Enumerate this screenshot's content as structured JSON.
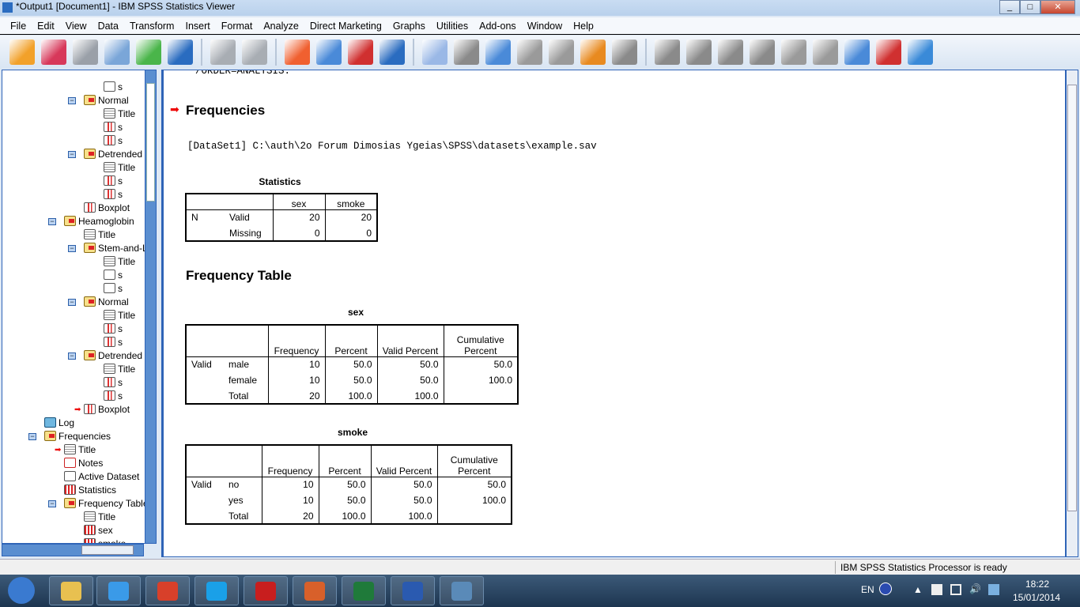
{
  "window": {
    "title": "*Output1 [Document1] - IBM SPSS Statistics Viewer",
    "buttons": [
      "minimize",
      "maximize",
      "close"
    ]
  },
  "menu": [
    "File",
    "Edit",
    "View",
    "Data",
    "Transform",
    "Insert",
    "Format",
    "Analyze",
    "Direct Marketing",
    "Graphs",
    "Utilities",
    "Add-ons",
    "Window",
    "Help"
  ],
  "toolbar": [
    {
      "icon": "open-folder-icon",
      "color": "#f2a12a"
    },
    {
      "icon": "save-icon",
      "color": "#d7385a"
    },
    {
      "icon": "print-icon",
      "color": "#9aa0a8"
    },
    {
      "icon": "print-preview-icon",
      "color": "#7aa6d8"
    },
    {
      "icon": "export-icon",
      "color": "#4ab54a"
    },
    {
      "icon": "recall-dialog-icon",
      "color": "#2a6cc0"
    },
    {
      "sep": true
    },
    {
      "icon": "undo-icon",
      "color": "#a8adb3"
    },
    {
      "icon": "redo-icon",
      "color": "#a8adb3"
    },
    {
      "sep": true
    },
    {
      "icon": "goto-data-icon",
      "color": "#f06030"
    },
    {
      "icon": "goto-case-icon",
      "color": "#4a8ad8"
    },
    {
      "icon": "goto-variable-icon",
      "color": "#d03030"
    },
    {
      "icon": "variables-icon",
      "color": "#2a6cc0"
    },
    {
      "sep": true
    },
    {
      "icon": "use-sets-icon",
      "color": "#9ab8e6"
    },
    {
      "icon": "show-all-variables-icon",
      "color": "#8a8a8a"
    },
    {
      "icon": "spell-check-icon",
      "color": "#4a8ad8"
    },
    {
      "icon": "promote-icon",
      "color": "#9a9a9a"
    },
    {
      "icon": "designate-window-icon",
      "color": "#9a9a9a"
    },
    {
      "icon": "run-script-icon",
      "color": "#e88a20"
    },
    {
      "icon": "select-last-output-icon",
      "color": "#8a8a8a"
    },
    {
      "sep": true
    },
    {
      "icon": "arrow-left-icon",
      "color": "#8a8a8a"
    },
    {
      "icon": "arrow-right-icon",
      "color": "#8a8a8a"
    },
    {
      "icon": "expand-plus-icon",
      "color": "#8a8a8a"
    },
    {
      "icon": "collapse-minus-icon",
      "color": "#8a8a8a"
    },
    {
      "icon": "show-icon",
      "color": "#9a9a9a"
    },
    {
      "icon": "hide-icon",
      "color": "#9a9a9a"
    },
    {
      "icon": "insert-heading-icon",
      "color": "#4a8ad8"
    },
    {
      "icon": "insert-title-icon",
      "color": "#d03030"
    },
    {
      "icon": "insert-text-icon",
      "color": "#3a8ad8"
    }
  ],
  "tree": [
    {
      "level": 4,
      "icon": "doc",
      "label": "s"
    },
    {
      "level": 3,
      "icon": "book",
      "label": "Normal",
      "minus": true
    },
    {
      "level": 4,
      "icon": "title",
      "label": "Title"
    },
    {
      "level": 4,
      "icon": "chart",
      "label": "s"
    },
    {
      "level": 4,
      "icon": "chart",
      "label": "s"
    },
    {
      "level": 3,
      "icon": "book",
      "label": "Detrended",
      "minus": true
    },
    {
      "level": 4,
      "icon": "title",
      "label": "Title"
    },
    {
      "level": 4,
      "icon": "chart",
      "label": "s"
    },
    {
      "level": 4,
      "icon": "chart",
      "label": "s"
    },
    {
      "level": 3,
      "icon": "chart",
      "label": "Boxplot"
    },
    {
      "level": 2,
      "icon": "book",
      "label": "Heamoglobin",
      "minus": true
    },
    {
      "level": 3,
      "icon": "title",
      "label": "Title"
    },
    {
      "level": 3,
      "icon": "book",
      "label": "Stem-and-Leaf",
      "minus": true
    },
    {
      "level": 4,
      "icon": "title",
      "label": "Title"
    },
    {
      "level": 4,
      "icon": "doc",
      "label": "s"
    },
    {
      "level": 4,
      "icon": "doc",
      "label": "s"
    },
    {
      "level": 3,
      "icon": "book",
      "label": "Normal",
      "minus": true
    },
    {
      "level": 4,
      "icon": "title",
      "label": "Title"
    },
    {
      "level": 4,
      "icon": "chart",
      "label": "s"
    },
    {
      "level": 4,
      "icon": "chart",
      "label": "s"
    },
    {
      "level": 3,
      "icon": "book",
      "label": "Detrended",
      "minus": true
    },
    {
      "level": 4,
      "icon": "title",
      "label": "Title"
    },
    {
      "level": 4,
      "icon": "chart",
      "label": "s"
    },
    {
      "level": 4,
      "icon": "chart",
      "label": "s"
    },
    {
      "level": 3,
      "icon": "chart",
      "label": "Boxplot",
      "arrow": true
    },
    {
      "level": 1,
      "icon": "log",
      "label": "Log"
    },
    {
      "level": 1,
      "icon": "book",
      "label": "Frequencies",
      "minus": true
    },
    {
      "level": 2,
      "icon": "title",
      "label": "Title",
      "arrow": true
    },
    {
      "level": 2,
      "icon": "notes",
      "label": "Notes"
    },
    {
      "level": 2,
      "icon": "doc",
      "label": "Active Dataset"
    },
    {
      "level": 2,
      "icon": "table",
      "label": "Statistics"
    },
    {
      "level": 2,
      "icon": "book",
      "label": "Frequency Table",
      "minus": true
    },
    {
      "level": 3,
      "icon": "title",
      "label": "Title"
    },
    {
      "level": 3,
      "icon": "table",
      "label": "sex"
    },
    {
      "level": 3,
      "icon": "table",
      "label": "smoke"
    }
  ],
  "output": {
    "syntax_tail": "/ORDER=ANALYSIS.",
    "heading": "Frequencies",
    "dataset": "[DataSet1] C:\\auth\\2o Forum Dimosias Ygeias\\SPSS\\datasets\\example.sav",
    "statistics": {
      "title": "Statistics",
      "cols": [
        "sex",
        "smoke"
      ],
      "rows": [
        [
          "N",
          "Valid",
          "20",
          "20"
        ],
        [
          "",
          "Missing",
          "0",
          "0"
        ]
      ]
    },
    "freq_heading": "Frequency Table",
    "tables": [
      {
        "title": "sex",
        "cols": [
          "Frequency",
          "Percent",
          "Valid Percent",
          "Cumulative Percent"
        ],
        "rows": [
          [
            "Valid",
            "male",
            "10",
            "50.0",
            "50.0",
            "50.0"
          ],
          [
            "",
            "female",
            "10",
            "50.0",
            "50.0",
            "100.0"
          ],
          [
            "",
            "Total",
            "20",
            "100.0",
            "100.0",
            ""
          ]
        ]
      },
      {
        "title": "smoke",
        "cols": [
          "Frequency",
          "Percent",
          "Valid Percent",
          "Cumulative Percent"
        ],
        "rows": [
          [
            "Valid",
            "no",
            "10",
            "50.0",
            "50.0",
            "50.0"
          ],
          [
            "",
            "yes",
            "10",
            "50.0",
            "50.0",
            "100.0"
          ],
          [
            "",
            "Total",
            "20",
            "100.0",
            "100.0",
            ""
          ]
        ]
      }
    ]
  },
  "status": {
    "message": "IBM SPSS Statistics Processor is ready"
  },
  "taskbar": {
    "apps": [
      {
        "icon": "start-orb-icon",
        "color": "#3a7ad0"
      },
      {
        "icon": "file-explorer-icon",
        "color": "#e8c050"
      },
      {
        "icon": "internet-explorer-icon",
        "color": "#3a9ae8"
      },
      {
        "icon": "chrome-icon",
        "color": "#d8402a"
      },
      {
        "icon": "skype-icon",
        "color": "#1aa0e8"
      },
      {
        "icon": "acrobat-icon",
        "color": "#c81e1e"
      },
      {
        "icon": "powerpoint-icon",
        "color": "#d8602a"
      },
      {
        "icon": "excel-icon",
        "color": "#1f7a3a"
      },
      {
        "icon": "word-icon",
        "color": "#2a5ab0"
      },
      {
        "icon": "spss-icon",
        "color": "#5a8ab8"
      }
    ],
    "language": "EN",
    "time": "18:22",
    "date": "15/01/2014"
  }
}
